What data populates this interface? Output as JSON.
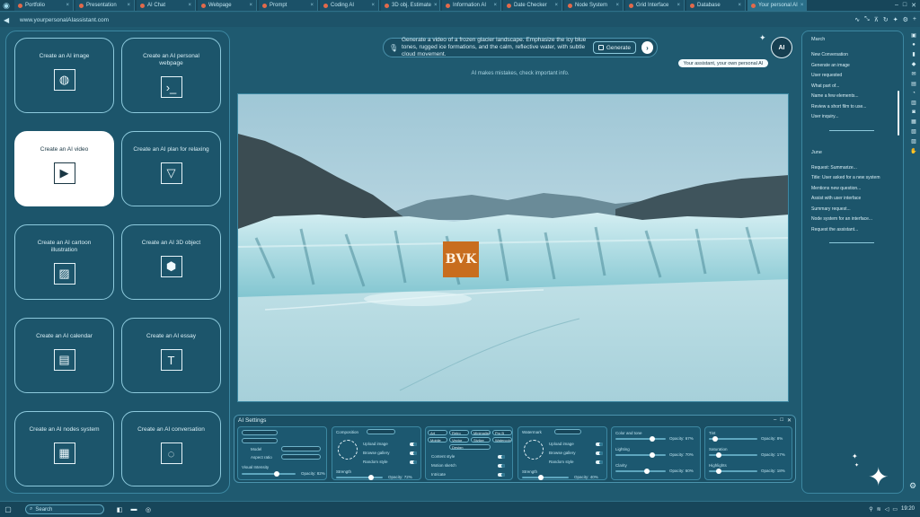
{
  "browser": {
    "tabs": [
      {
        "label": "Portfolio"
      },
      {
        "label": "Presentation"
      },
      {
        "label": "AI Chat"
      },
      {
        "label": "Webpage"
      },
      {
        "label": "Prompt"
      },
      {
        "label": "Coding AI"
      },
      {
        "label": "3D obj. Estimate"
      },
      {
        "label": "Information AI"
      },
      {
        "label": "Date Checker"
      },
      {
        "label": "Node System"
      },
      {
        "label": "Grid Interface"
      },
      {
        "label": "Database"
      },
      {
        "label": "Your personal AI",
        "active": true
      }
    ],
    "url": "www.yourpersonalAIassistant.com"
  },
  "cards": [
    {
      "title": "Create an AI image",
      "icon": "image-icon"
    },
    {
      "title": "Create an AI personal webpage",
      "icon": "terminal-icon"
    },
    {
      "title": "Create an AI video",
      "icon": "play-icon",
      "selected": true
    },
    {
      "title": "Create an AI plan for relaxing",
      "icon": "cocktail-icon"
    },
    {
      "title": "Create an AI cartoon illustration",
      "icon": "illustration-icon"
    },
    {
      "title": "Create an AI 3D object",
      "icon": "cube-icon"
    },
    {
      "title": "Create an AI calendar",
      "icon": "calendar-icon"
    },
    {
      "title": "Create an AI essay",
      "icon": "text-icon"
    },
    {
      "title": "Create an AI nodes system",
      "icon": "grid-icon"
    },
    {
      "title": "Create an AI conversation",
      "icon": "dots-circle-icon"
    }
  ],
  "prompt": {
    "text": "Generate a video of a frozen glacier landscape. Emphasize the icy blue tones, rugged ice formations, and the calm, reflective water, with subtle cloud movement.",
    "generate_label": "Generate",
    "disclaimer": "AI makes mistakes, check important info."
  },
  "assistant": {
    "avatar_label": "AI",
    "tooltip": "Your assistant, your own personal AI"
  },
  "watermark": "BVK",
  "settings": {
    "title": "AI Settings",
    "labels": {
      "model": "Model",
      "aspect": "Aspect ratio",
      "visual_intensity": "Visual Intensity",
      "composition": "Composition",
      "upload_image": "Upload image",
      "browse_gallery": "Browse gallery",
      "random_style": "Random style",
      "strength": "Strength",
      "style": "Style",
      "art": "Art",
      "retro": "Retro",
      "minimalist": "Minimalist",
      "pro_b": "Pro B",
      "mobile": "Mobile",
      "vector": "Vector",
      "stylize": "Stylize",
      "watercolor": "Watercolor",
      "portfolio": "Portfolio",
      "design": "Design",
      "content_style": "Content style",
      "motion_sketch": "Motion sketch",
      "intricate": "Intricate",
      "watermark": "Watermark",
      "color_and_tone": "Color and tone",
      "lighting": "Lighting",
      "clarity": "Clarity",
      "tint": "Tint",
      "saturation": "Saturation",
      "highlights": "Highlights",
      "opacity_82": "Opacity: 82%",
      "opacity_72": "Opacity: 72%",
      "opacity_40": "Opacity: 40%",
      "opacity_67": "Opacity: 67%",
      "opacity_70": "Opacity: 70%",
      "opacity_60": "Opacity: 60%",
      "opacity_8": "Opacity: 8%",
      "opacity_17": "Opacity: 17%",
      "opacity_18": "Opacity: 18%"
    }
  },
  "history": {
    "sections": [
      {
        "heading": "March",
        "items": [
          "New Conversation",
          "Generate an image",
          "User requested",
          "What part of...",
          "Name a few elements...",
          "Review a short film to use...",
          "User inquiry..."
        ]
      },
      {
        "heading": "June",
        "items": [
          "Request: Summarize...",
          "Title: User asked for a new system",
          "Mentions new question...",
          "Assist with user interface",
          "Summary request...",
          "Node system for an interface...",
          "Request the assistant..."
        ]
      }
    ]
  },
  "taskbar": {
    "search_placeholder": "Search",
    "time": "19:20"
  },
  "colors": {
    "background": "#1f5a70",
    "panel": "#1c556b",
    "border": "#8cc9dc",
    "accent_white": "#ffffff",
    "watermark": "#c86d1e"
  }
}
